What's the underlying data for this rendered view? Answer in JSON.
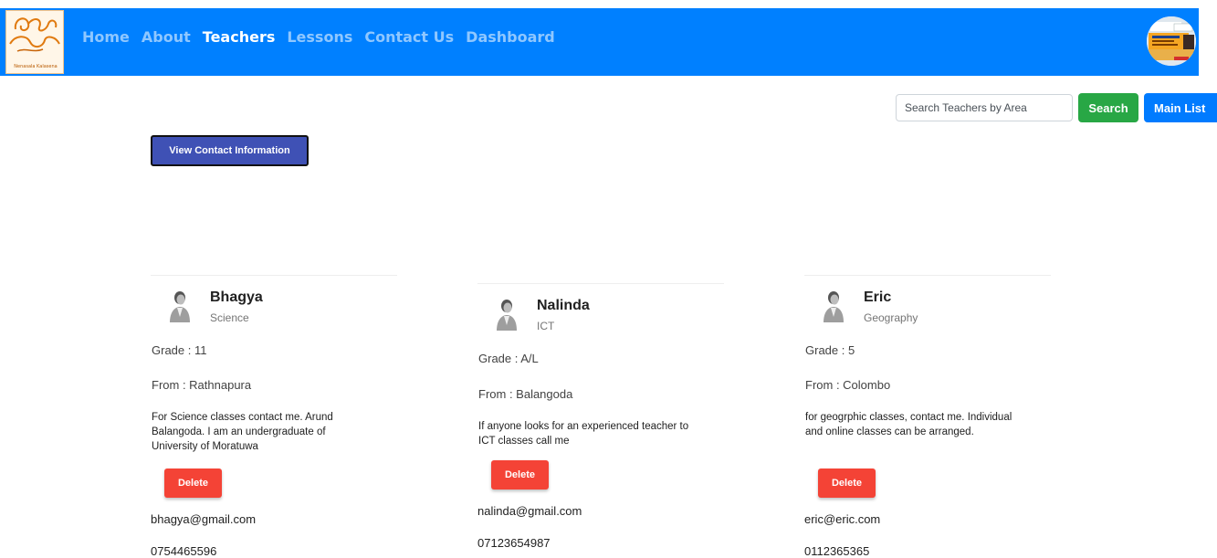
{
  "nav": {
    "logo_text": "Nenasala Kalasena",
    "links": [
      {
        "label": "Home",
        "active": false
      },
      {
        "label": "About",
        "active": false
      },
      {
        "label": "Teachers",
        "active": true
      },
      {
        "label": "Lessons",
        "active": false
      },
      {
        "label": "Contact Us",
        "active": false
      },
      {
        "label": "Dashboard",
        "active": false
      }
    ]
  },
  "search": {
    "placeholder": "Search Teachers by Area",
    "value": "",
    "search_label": "Search",
    "main_list_label": "Main List"
  },
  "contact_button_label": "View Contact Information",
  "teachers": [
    {
      "name": "Bhagya",
      "subject": "Science",
      "grade": "Grade : 11",
      "from": "From : Rathnapura",
      "description": "For Science classes contact me. Arund Balangoda. I am an undergraduate of University of Moratuwa",
      "delete_label": "Delete",
      "email": "bhagya@gmail.com",
      "phone": "0754465596"
    },
    {
      "name": "Nalinda",
      "subject": "ICT",
      "grade": "Grade : A/L",
      "from": "From : Balangoda",
      "description": "If anyone looks for an experienced teacher to ICT classes call me",
      "delete_label": "Delete",
      "email": "nalinda@gmail.com",
      "phone": "07123654987"
    },
    {
      "name": "Eric",
      "subject": "Geography",
      "grade": "Grade : 5",
      "from": "From : Colombo",
      "description": "for geogrphic classes, contact me. Individual and online classes can be arranged.",
      "delete_label": "Delete",
      "email": "eric@eric.com",
      "phone": "0112365365"
    }
  ],
  "colors": {
    "navbar": "#0080ff",
    "nav_active": "#ffffff",
    "nav_inactive": "#8fc7ff",
    "search_button": "#28a745",
    "main_list_button": "#007bff",
    "contact_button": "#3f51b5",
    "delete_button": "#f44336"
  }
}
